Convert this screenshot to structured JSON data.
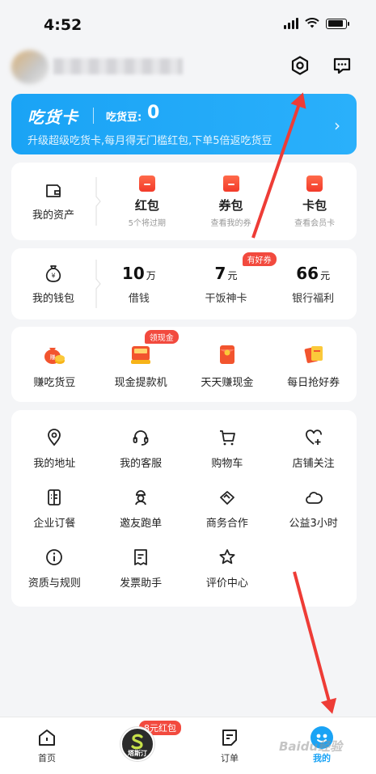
{
  "status_bar": {
    "time": "4:52"
  },
  "vip": {
    "title": "吃货卡",
    "beans_label": "吃货豆:",
    "beans_value": "0",
    "subtitle": "升级超级吃货卡,每月得无门槛红包,下单5倍返吃货豆"
  },
  "assets": {
    "label": "我的资产",
    "items": [
      {
        "title": "红包",
        "sub": "5个将过期"
      },
      {
        "title": "券包",
        "sub": "查看我的券"
      },
      {
        "title": "卡包",
        "sub": "查看会员卡"
      }
    ]
  },
  "wallet": {
    "label": "我的钱包",
    "items": [
      {
        "num": "10",
        "unit": "万",
        "label": "借钱",
        "tag": ""
      },
      {
        "num": "7",
        "unit": "元",
        "label": "干饭神卡",
        "tag": "有好券"
      },
      {
        "num": "66",
        "unit": "元",
        "label": "银行福利",
        "tag": ""
      }
    ]
  },
  "promos": [
    {
      "label": "赚吃货豆",
      "tag": ""
    },
    {
      "label": "现金提款机",
      "tag": "领现金"
    },
    {
      "label": "天天赚现金",
      "tag": ""
    },
    {
      "label": "每日抢好券",
      "tag": ""
    }
  ],
  "tools": [
    {
      "label": "我的地址",
      "icon": "location-icon"
    },
    {
      "label": "我的客服",
      "icon": "headset-icon"
    },
    {
      "label": "购物车",
      "icon": "cart-icon"
    },
    {
      "label": "店铺关注",
      "icon": "heart-plus-icon"
    },
    {
      "label": "企业订餐",
      "icon": "building-icon"
    },
    {
      "label": "邀友跑单",
      "icon": "rider-icon"
    },
    {
      "label": "商务合作",
      "icon": "handshake-icon"
    },
    {
      "label": "公益3小时",
      "icon": "cloud-icon"
    },
    {
      "label": "资质与规则",
      "icon": "info-icon"
    },
    {
      "label": "发票助手",
      "icon": "invoice-icon"
    },
    {
      "label": "评价中心",
      "icon": "star-icon"
    }
  ],
  "tabbar": {
    "home": "首页",
    "center_tag": "8元红包",
    "center_logo_text": "塔斯汀",
    "orders": "订单",
    "mine": "我的"
  },
  "watermark": "Baidu经验",
  "colors": {
    "accent": "#1aa3f5",
    "red": "#f24a3e",
    "arrow": "#ee3c36"
  }
}
